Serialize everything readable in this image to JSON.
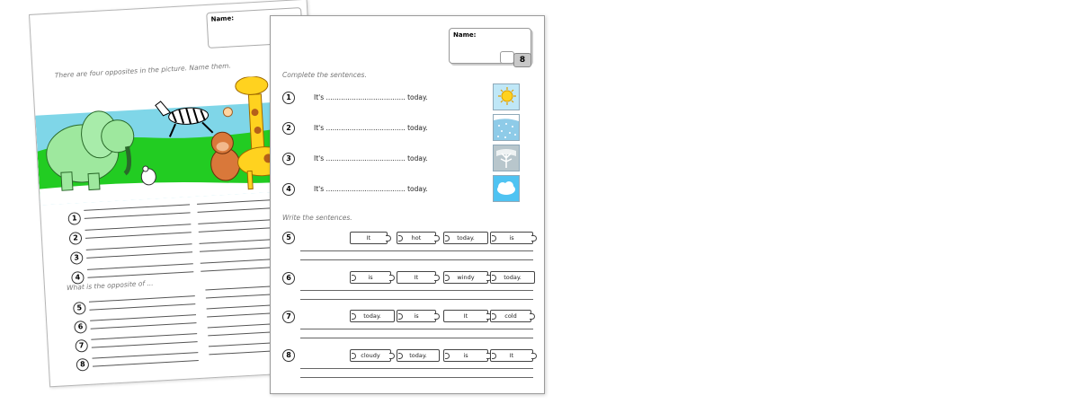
{
  "back_sheet": {
    "name_label": "Name:",
    "instruction_1": "There are four opposites in the picture. Name them.",
    "instruction_2": "What is the opposite of ...",
    "numbers": [
      "1",
      "2",
      "3",
      "4",
      "5",
      "6",
      "7",
      "8"
    ]
  },
  "front_sheet": {
    "name_label": "Name:",
    "page_number": "8",
    "instruction_1": "Complete the sentences.",
    "instruction_2": "Write the sentences.",
    "sentences": [
      {
        "num": "1",
        "text": "It's ..................................... today.",
        "weather": "sun-icon"
      },
      {
        "num": "2",
        "text": "It's ..................................... today.",
        "weather": "snow-icon"
      },
      {
        "num": "3",
        "text": "It's ..................................... today.",
        "weather": "wind-icon"
      },
      {
        "num": "4",
        "text": "It's ..................................... today.",
        "weather": "cloud-icon"
      }
    ],
    "puzzles": [
      {
        "num": "5",
        "words": [
          "It",
          "hot",
          "today.",
          "is"
        ]
      },
      {
        "num": "6",
        "words": [
          "is",
          "It",
          "windy",
          "today."
        ]
      },
      {
        "num": "7",
        "words": [
          "today.",
          "is",
          "It",
          "cold"
        ]
      },
      {
        "num": "8",
        "words": [
          "cloudy",
          "today.",
          "is",
          "It"
        ]
      }
    ]
  },
  "colors": {
    "grass": "#22cc22",
    "sky": "#7fd6e8",
    "elephant": "#9ee89e",
    "giraffe": "#ffd21f",
    "monkey": "#d9783a"
  }
}
